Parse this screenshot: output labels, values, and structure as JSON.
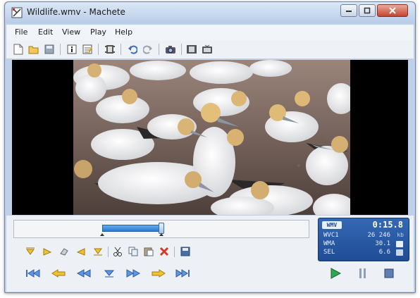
{
  "window": {
    "title": "Wildlife.wmv - Machete"
  },
  "menu": [
    "File",
    "Edit",
    "View",
    "Play",
    "Help"
  ],
  "toolbar": {
    "icons": [
      "new-file-icon",
      "open-folder-icon",
      "save-icon",
      "info-icon",
      "properties-icon",
      "film-strip-icon",
      "undo-icon",
      "redo-icon",
      "snapshot-camera-icon",
      "video-frame-icon",
      "tv-icon"
    ]
  },
  "info_panel": {
    "format": "WMV",
    "time": "0:15.8",
    "rows": [
      {
        "label": "WVC1",
        "value": "26 246",
        "unit": "kb"
      },
      {
        "label": "WMA",
        "value": "30.1",
        "unit": ""
      },
      {
        "label": "SEL",
        "value": "6.6",
        "unit": ""
      }
    ]
  },
  "timeline": {
    "selection_start": 0.29,
    "selection_end": 0.5,
    "position": 0.5
  },
  "colors": {
    "accent": "#3a86d8",
    "panel": "#2a5aa8",
    "play": "#2fa84f"
  }
}
